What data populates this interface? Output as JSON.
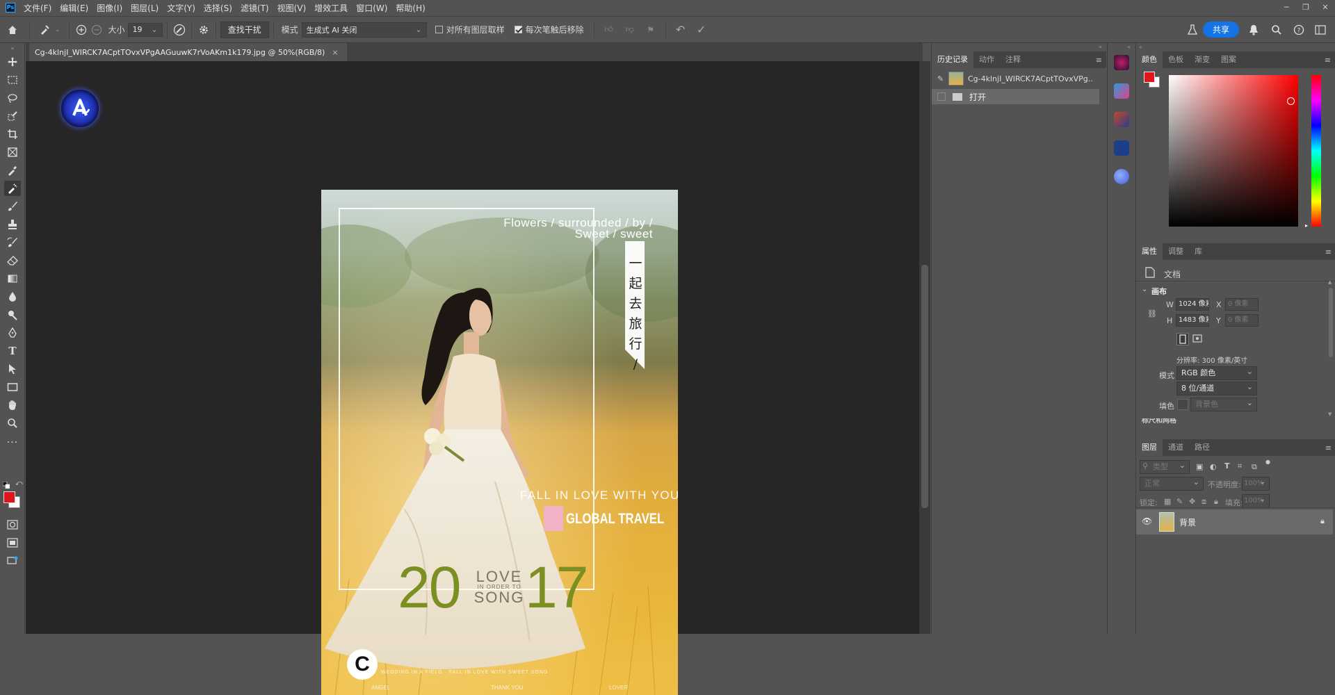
{
  "menubar": {
    "app_icon": "Ps",
    "items": [
      "文件(F)",
      "编辑(E)",
      "图像(I)",
      "图层(L)",
      "文字(Y)",
      "选择(S)",
      "滤镜(T)",
      "视图(V)",
      "增效工具",
      "窗口(W)",
      "帮助(H)"
    ],
    "window_controls": [
      "minimize-icon",
      "restore-icon",
      "close-icon"
    ]
  },
  "options": {
    "size_label": "大小",
    "size_value": "19",
    "content_aware_label": "查找干扰",
    "mode_label": "模式",
    "mode_value": "生成式 AI 关闭",
    "sample_all_label": "对所有图层取样",
    "remove_after_label": "每次笔触后移除",
    "share_label": "共享"
  },
  "document": {
    "tab_title": "Cg-4klnjI_WIRCK7ACptTOvxVPgAAGuuwK7rVoAKm1k179.jpg @ 50%(RGB/8)",
    "close": "×"
  },
  "poster": {
    "top_text_1": "Flowers / surrounded / by /",
    "top_text_2": "Sweet / sweet",
    "vertical_chars": [
      "一",
      "起",
      "去",
      "旅",
      "行",
      "/"
    ],
    "fall_text": "FALL IN LOVE WITH YOU",
    "global_travel": "GLOBAL TRAVEL",
    "year_left": "20",
    "year_right": "17",
    "love": "LOVE",
    "in_order_to": "IN ORDER TO",
    "song": "SONG",
    "logo_letter": "C",
    "bottom_line": "WEDDING IN A FIELD · FALL IN LOVE WITH SWEET SONG",
    "footer": [
      "ANGEL",
      "THANK YOU",
      "LOVER"
    ]
  },
  "history": {
    "tabs": [
      "历史记录",
      "动作",
      "注释"
    ],
    "snapshot_name": "Cg-4klnjI_WIRCK7ACptTOvxVPg...",
    "open_step": "打开"
  },
  "color_panel": {
    "tabs": [
      "颜色",
      "色板",
      "渐变",
      "图案"
    ],
    "foreground": "#e0161e",
    "background": "#ffffff",
    "hue": "#ff0000"
  },
  "properties": {
    "tabs": [
      "属性",
      "调整",
      "库"
    ],
    "doc_label": "文档",
    "canvas_label": "画布",
    "w_label": "W",
    "w_value": "1024 像素",
    "x_label": "X",
    "x_value": "0 像素",
    "h_label": "H",
    "h_value": "1483 像素",
    "y_label": "Y",
    "y_value": "0 像素",
    "resolution": "分辨率: 300 像素/英寸",
    "mode_label": "模式",
    "mode_value": "RGB 颜色",
    "depth_value": "8 位/通道",
    "fill_label": "填色",
    "fill_value": "背景色",
    "cut_text": "标尺和网格"
  },
  "layers": {
    "tabs": [
      "图层",
      "通道",
      "路径"
    ],
    "search_placeholder": "类型",
    "blend_mode": "正常",
    "opacity_label": "不透明度:",
    "opacity_value": "100%",
    "lock_label": "锁定:",
    "fill_label": "填充:",
    "fill_value": "100%",
    "layer_name": "背景"
  }
}
